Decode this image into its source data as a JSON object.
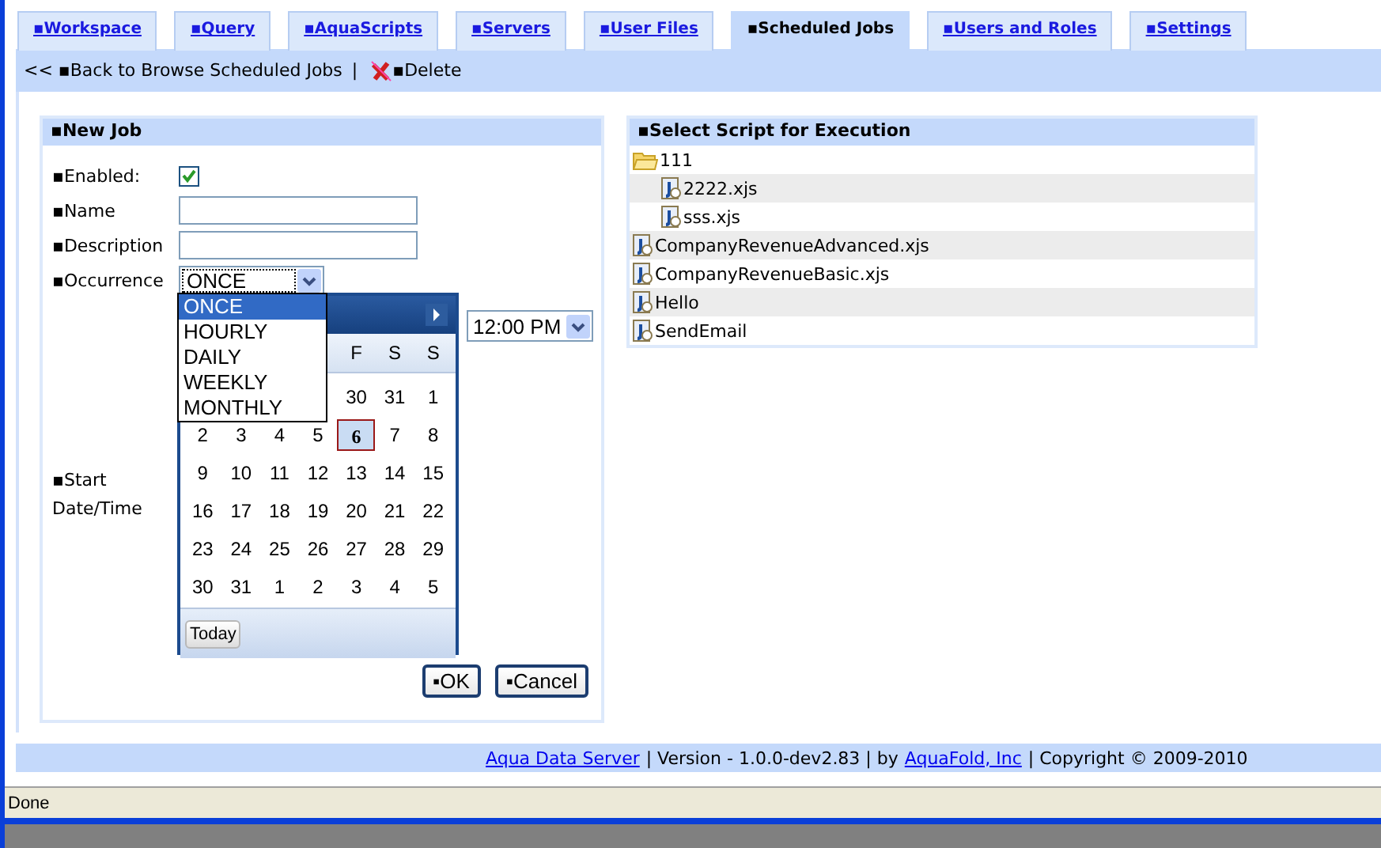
{
  "tabs": [
    {
      "label": "▪Workspace",
      "selected": false
    },
    {
      "label": "▪Query",
      "selected": false
    },
    {
      "label": "▪AquaScripts",
      "selected": false
    },
    {
      "label": "▪Servers",
      "selected": false
    },
    {
      "label": "▪User Files",
      "selected": false
    },
    {
      "label": "▪Scheduled Jobs",
      "selected": true
    },
    {
      "label": "▪Users and Roles",
      "selected": false
    },
    {
      "label": "▪Settings",
      "selected": false
    }
  ],
  "toolbar": {
    "back": "<< ▪Back to Browse Scheduled Jobs",
    "separator": "|",
    "delete": "▪Delete"
  },
  "new_job": {
    "title": "▪New Job",
    "enabled": {
      "label": "▪Enabled:",
      "checked": true
    },
    "name": {
      "label": "▪Name"
    },
    "description": {
      "label": "▪Description"
    },
    "occurrence": {
      "label": "▪Occurrence",
      "value": "ONCE",
      "expanded": true,
      "options": [
        {
          "label": "ONCE",
          "selected": true
        },
        {
          "label": "HOURLY",
          "selected": false
        },
        {
          "label": "DAILY",
          "selected": false
        },
        {
          "label": "WEEKLY",
          "selected": false
        },
        {
          "label": "MONTHLY",
          "selected": false
        }
      ]
    },
    "start": {
      "label": "▪Start Date/Time",
      "time": "12:00 PM"
    },
    "calendar": {
      "day_headers": [
        "F",
        "S",
        "S"
      ],
      "weeks": [
        [
          {
            "day": "30",
            "selected": false
          },
          {
            "day": "31",
            "selected": false
          },
          {
            "day": "1",
            "selected": false
          }
        ],
        [
          {
            "day": "2",
            "selected": false
          },
          {
            "day": "3",
            "selected": false
          },
          {
            "day": "4",
            "selected": false
          },
          {
            "day": "5",
            "selected": false
          },
          {
            "day": "6",
            "selected": true
          },
          {
            "day": "7",
            "selected": false
          },
          {
            "day": "8",
            "selected": false
          }
        ],
        [
          {
            "day": "9",
            "selected": false
          },
          {
            "day": "10",
            "selected": false
          },
          {
            "day": "11",
            "selected": false
          },
          {
            "day": "12",
            "selected": false
          },
          {
            "day": "13",
            "selected": false
          },
          {
            "day": "14",
            "selected": false
          },
          {
            "day": "15",
            "selected": false
          }
        ],
        [
          {
            "day": "16",
            "selected": false
          },
          {
            "day": "17",
            "selected": false
          },
          {
            "day": "18",
            "selected": false
          },
          {
            "day": "19",
            "selected": false
          },
          {
            "day": "20",
            "selected": false
          },
          {
            "day": "21",
            "selected": false
          },
          {
            "day": "22",
            "selected": false
          }
        ],
        [
          {
            "day": "23",
            "selected": false
          },
          {
            "day": "24",
            "selected": false
          },
          {
            "day": "25",
            "selected": false
          },
          {
            "day": "26",
            "selected": false
          },
          {
            "day": "27",
            "selected": false
          },
          {
            "day": "28",
            "selected": false
          },
          {
            "day": "29",
            "selected": false
          }
        ],
        [
          {
            "day": "30",
            "selected": false
          },
          {
            "day": "31",
            "selected": false
          },
          {
            "day": "1",
            "selected": false
          },
          {
            "day": "2",
            "selected": false
          },
          {
            "day": "3",
            "selected": false
          },
          {
            "day": "4",
            "selected": false
          },
          {
            "day": "5",
            "selected": false
          }
        ]
      ],
      "today_button": "Today"
    },
    "buttons": [
      "▪OK",
      "▪Cancel"
    ]
  },
  "scripts": {
    "title": "▪Select Script for Execution",
    "items": [
      {
        "kind": "folder",
        "label": "111",
        "children": [
          {
            "kind": "script",
            "label": "2222.xjs"
          },
          {
            "kind": "script",
            "label": "sss.xjs"
          }
        ]
      },
      {
        "kind": "script",
        "label": "CompanyRevenueAdvanced.xjs"
      },
      {
        "kind": "script",
        "label": "CompanyRevenueBasic.xjs"
      },
      {
        "kind": "script",
        "label": "Hello"
      },
      {
        "kind": "script",
        "label": "SendEmail"
      }
    ]
  },
  "footer": {
    "product": "Aqua Data Server",
    "version": "| Version - 1.0.0-dev2.83 | by",
    "company": "AquaFold, Inc",
    "copyright": "| Copyright © 2009-2010"
  },
  "status_bar": "Done"
}
